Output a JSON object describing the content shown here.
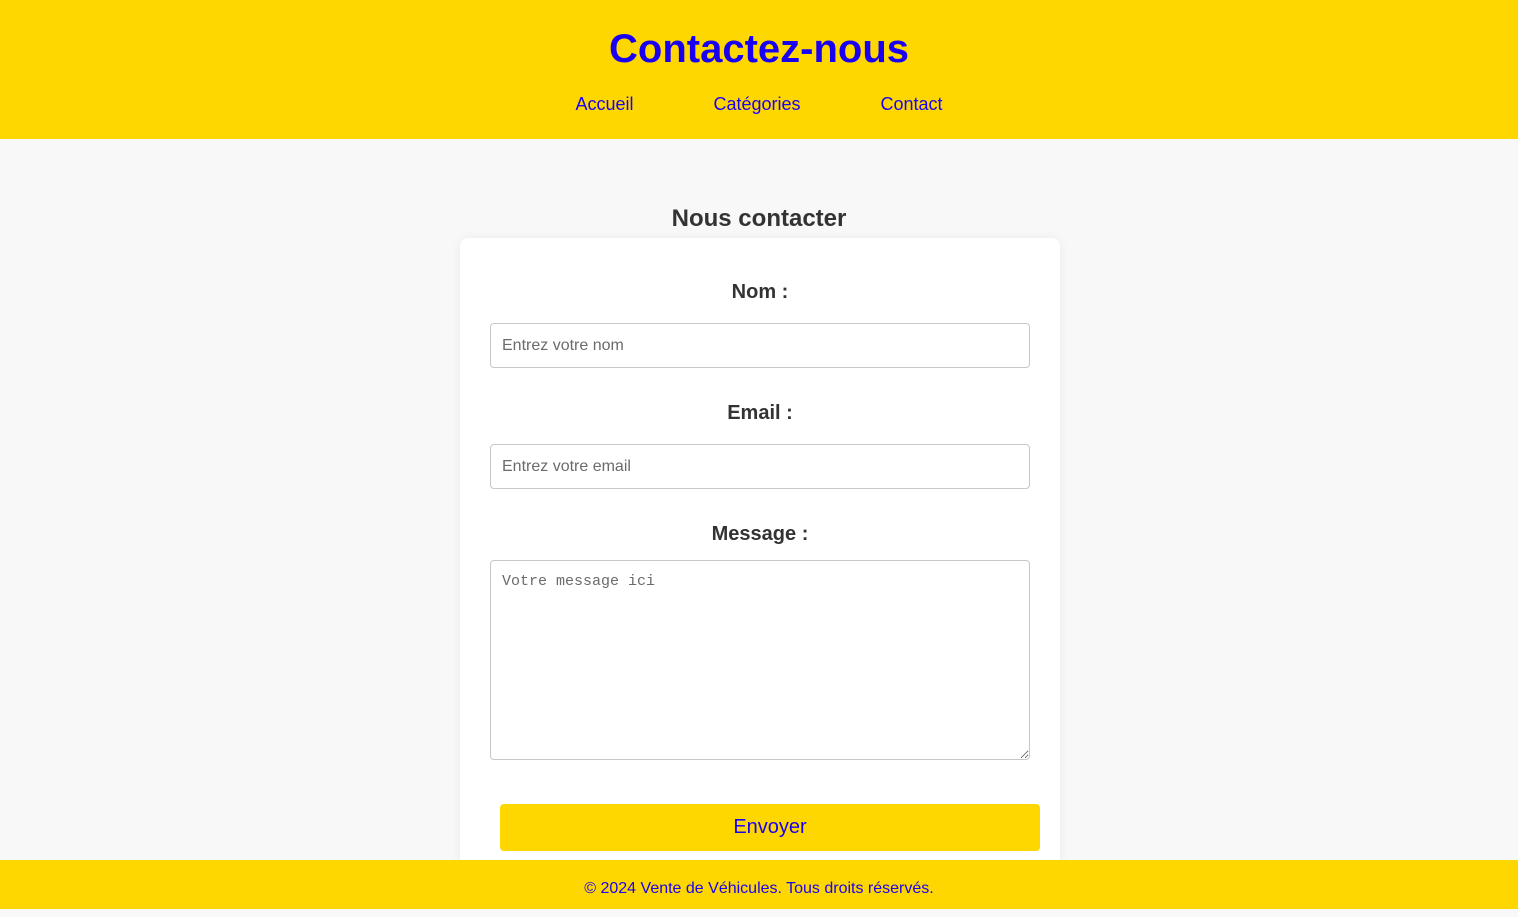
{
  "header": {
    "title": "Contactez-nous",
    "nav": [
      {
        "label": "Accueil"
      },
      {
        "label": "Catégories"
      },
      {
        "label": "Contact"
      }
    ]
  },
  "main": {
    "section_title": "Nous contacter",
    "form": {
      "name_label": "Nom :",
      "name_placeholder": "Entrez votre nom",
      "name_value": "",
      "email_label": "Email :",
      "email_placeholder": "Entrez votre email",
      "email_value": "",
      "message_label": "Message :",
      "message_placeholder": "Votre message ici",
      "message_value": "",
      "submit_label": "Envoyer"
    }
  },
  "footer": {
    "text": "© 2024 Vente de Véhicules. Tous droits réservés."
  },
  "colors": {
    "accent": "#ffd700",
    "link": "#1a00f0",
    "text": "#333333",
    "background": "#f8f8f8"
  }
}
